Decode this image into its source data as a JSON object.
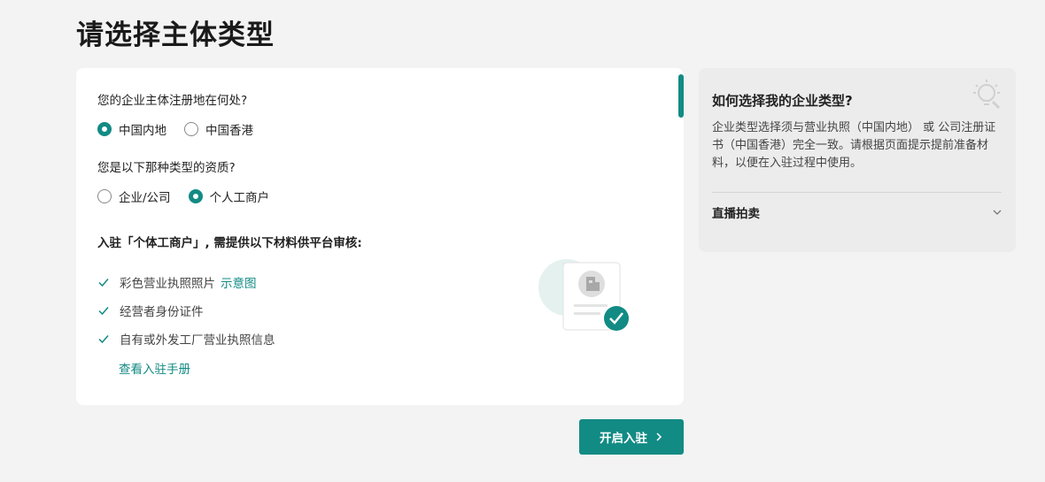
{
  "page": {
    "title": "请选择主体类型"
  },
  "main": {
    "q1": {
      "label": "您的企业主体注册地在何处?",
      "options": [
        {
          "label": "中国内地",
          "selected": true
        },
        {
          "label": "中国香港",
          "selected": false
        }
      ]
    },
    "q2": {
      "label": "您是以下那种类型的资质?",
      "options": [
        {
          "label": "企业/公司",
          "selected": false
        },
        {
          "label": "个人工商户",
          "selected": true
        }
      ]
    },
    "requirements": {
      "title": "入驻「个体工商户」, 需提供以下材料供平台审核:",
      "items": [
        {
          "label": "彩色营业执照照片",
          "link": "示意图"
        },
        {
          "label": "经营者身份证件"
        },
        {
          "label": "自有或外发工厂营业执照信息"
        }
      ],
      "manual_link": "查看入驻手册"
    }
  },
  "sidebar": {
    "title": "如何选择我的企业类型?",
    "text": "企业类型选择须与营业执照（中国内地） 或 公司注册证书（中国香港）完全一致。请根据页面提示提前准备材料，以便在入驻过程中使用。",
    "accordion": {
      "label": "直播拍卖"
    },
    "icons": [
      "lightbulb-icon",
      "chevron-down-icon"
    ]
  },
  "footer": {
    "start_button": "开启入驻"
  },
  "colors": {
    "accent": "#128b84",
    "background": "#f3f3f3",
    "card": "#ffffff",
    "side_card": "#ececec"
  }
}
